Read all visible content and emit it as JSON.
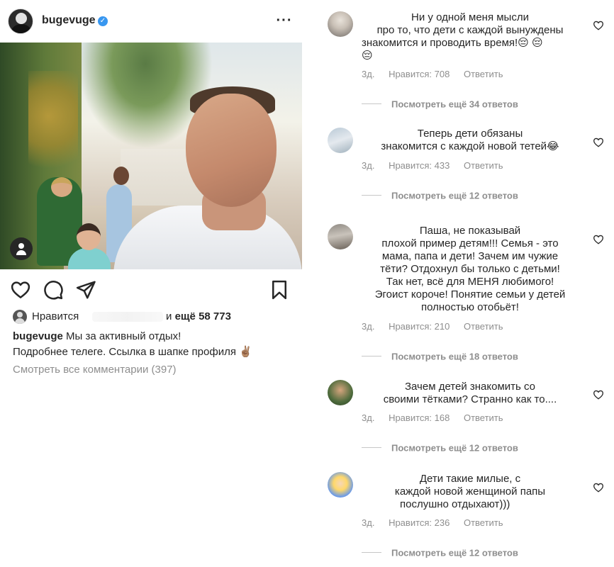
{
  "post": {
    "username": "bugevuge",
    "verified_mark": "✓",
    "more_icon": "more-horizontal-icon",
    "likes_label": "Нравится",
    "likes_and": "и",
    "likes_count": "ещё 58 773",
    "caption_user": "bugevuge",
    "caption_line1": "Мы за активный отдых!",
    "caption_line2": "Подробнее телеге. Ссылка в шапке профиля ✌🏽",
    "view_all_comments": "Смотреть все комментарии (397)"
  },
  "colors": {
    "text": "#262626",
    "muted": "#8e8e8e",
    "verified": "#3897f0"
  },
  "comments": [
    {
      "lines": [
        "Ни у одной меня мысли",
        "про то, что дети с каждой вынуждены",
        "знакомится и проводить время!😔 😔",
        "😔"
      ],
      "time": "3д.",
      "likes": "Нравится: 708",
      "reply": "Ответить",
      "more_replies": "Посмотреть ещё 34 ответов"
    },
    {
      "lines": [
        "Теперь дети обязаны",
        "знакомится с каждой новой тетей😂"
      ],
      "time": "3д.",
      "likes": "Нравится: 433",
      "reply": "Ответить",
      "more_replies": "Посмотреть ещё 12 ответов"
    },
    {
      "lines": [
        "Паша, не показывай",
        "плохой пример детям!!! Семья - это",
        "мама, папа и дети! Зачем им чужие",
        "тёти? Отдохнул бы только с детьми!",
        "Так нет, всё для МЕНЯ любимого!",
        "Эгоист короче! Понятие семьи у детей",
        "полностью отобьёт!"
      ],
      "time": "3д.",
      "likes": "Нравится: 210",
      "reply": "Ответить",
      "more_replies": "Посмотреть ещё 18 ответов"
    },
    {
      "lines": [
        "Зачем детей знакомить со",
        "своими тётками? Странно как то...."
      ],
      "time": "3д.",
      "likes": "Нравится: 168",
      "reply": "Ответить",
      "more_replies": "Посмотреть ещё 12 ответов"
    },
    {
      "lines": [
        "Дети такие милые, с",
        "каждой новой женщиной папы",
        "послушно отдыхают)))"
      ],
      "time": "3д.",
      "likes": "Нравится: 236",
      "reply": "Ответить",
      "more_replies": "Посмотреть ещё 12 ответов"
    }
  ]
}
